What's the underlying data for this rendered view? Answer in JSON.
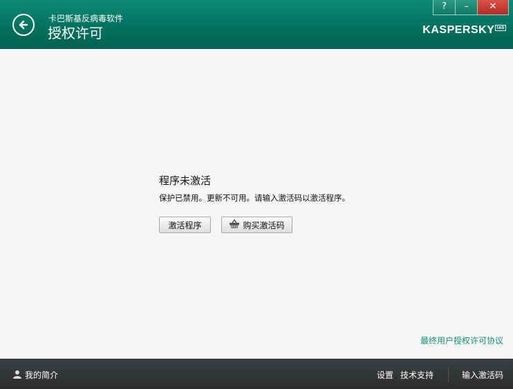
{
  "header": {
    "app_name": "卡巴斯基反病毒软件",
    "page_title": "授权许可",
    "logo_text": "KASPERSKY",
    "logo_badge": "lab",
    "window_buttons": [
      "?",
      "–",
      "✕"
    ],
    "accent_color": "#03725f"
  },
  "main": {
    "status_title": "程序未激活",
    "status_description": "保护已禁用。更新不可用。请输入激活码以激活程序。",
    "activate_button": "激活程序",
    "buy_button": "购买激活码",
    "buy_button_icon": "basket-icon",
    "eula_link": "最终用户授权许可协议",
    "link_color": "#17907c"
  },
  "footer": {
    "profile_label": "我的简介",
    "profile_icon": "user-icon",
    "settings_label": "设置",
    "support_label": "技术支持",
    "enter_code_label": "输入激活码"
  }
}
